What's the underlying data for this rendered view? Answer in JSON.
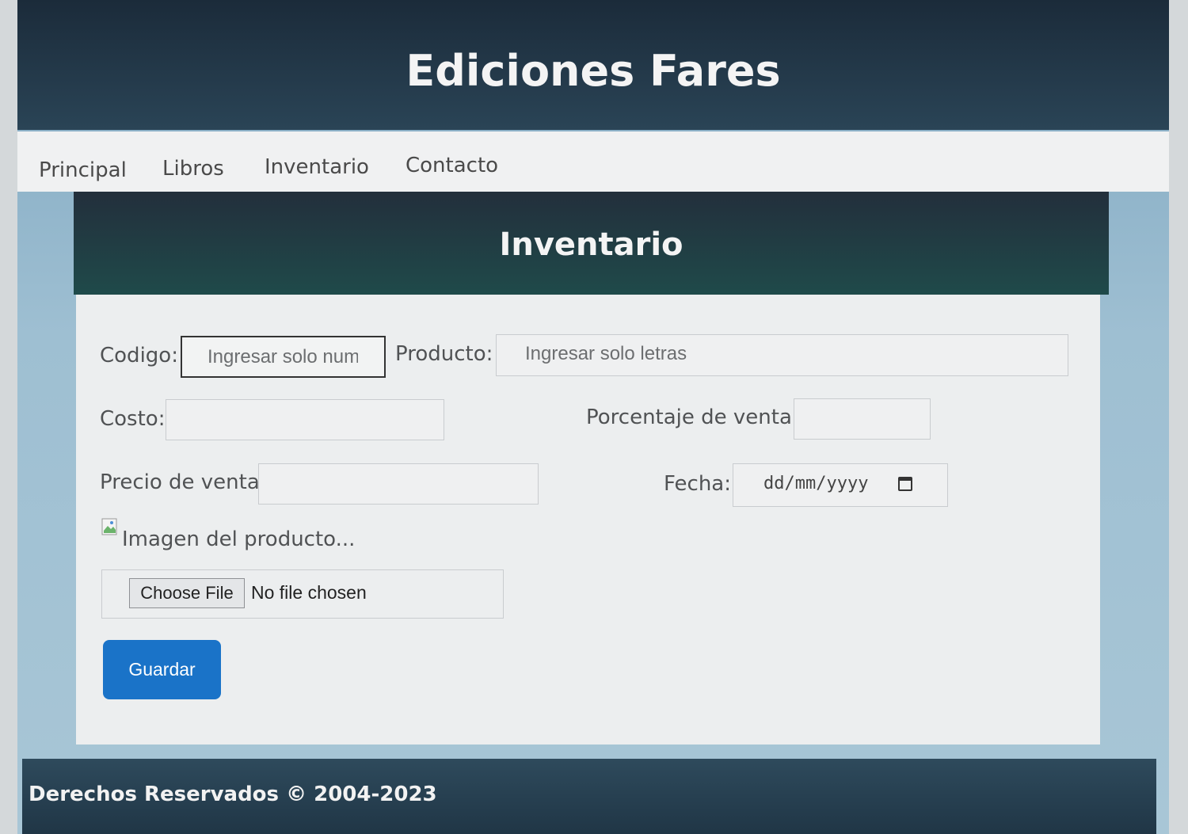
{
  "header": {
    "brand": "Ediciones Fares"
  },
  "nav": {
    "items": [
      {
        "label": "Principal"
      },
      {
        "label": "Libros"
      },
      {
        "label": "Inventario"
      },
      {
        "label": "Contacto"
      }
    ]
  },
  "panel": {
    "title": "Inventario"
  },
  "form": {
    "codigo": {
      "label": "Codigo:",
      "placeholder": "Ingresar solo numé"
    },
    "producto": {
      "label": "Producto:",
      "placeholder": "Ingresar solo letras"
    },
    "costo": {
      "label": "Costo:",
      "value": ""
    },
    "porcentaje": {
      "label": "Porcentaje de venta:",
      "value": ""
    },
    "precio": {
      "label": "Precio de venta:",
      "value": ""
    },
    "fecha": {
      "label": "Fecha:",
      "placeholder": "dd/mm/yyyy"
    },
    "imagen": {
      "alt_text": "Imagen del producto..."
    },
    "file": {
      "button_label": "Choose File",
      "status": "No file chosen"
    },
    "save_label": "Guardar"
  },
  "footer": {
    "text": "Derechos Reservados © 2004-2023"
  },
  "colors": {
    "header_bg": "#1b2b3a",
    "nav_bg": "#f0f1f2",
    "panel_head_bg": "#1f4a4a",
    "button_bg": "#1a73c8",
    "footer_bg": "#2e4a5c"
  },
  "icons": {
    "calendar": "calendar-icon",
    "broken_image": "broken-image-icon"
  }
}
